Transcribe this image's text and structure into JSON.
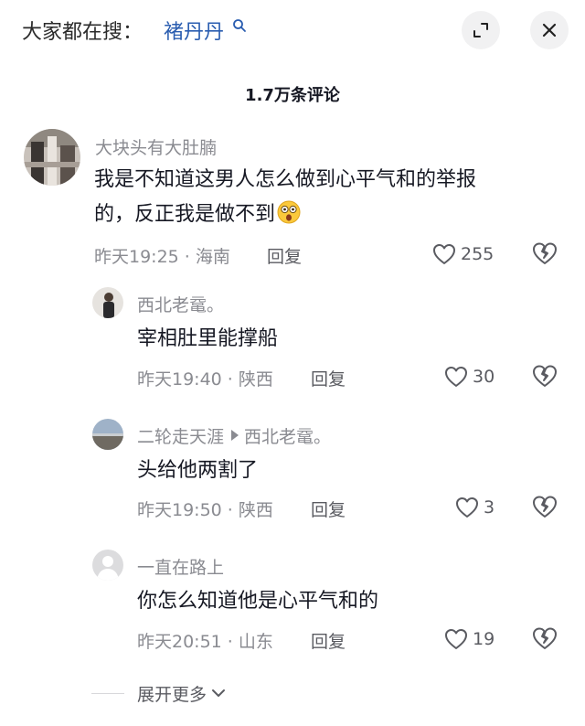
{
  "search": {
    "prefix": "大家都在搜：",
    "term": "褚丹丹"
  },
  "comments_header": {
    "count_label": "1.7万条评论"
  },
  "comments": [
    {
      "username": "大块头有大肚腩",
      "content_line1": "我是不知道这男人怎么做到心平气和的举报",
      "content_line2": "的，反正我是做不到",
      "time": "昨天19:25",
      "location": "海南",
      "reply_label": "回复",
      "likes": "255"
    }
  ],
  "replies": [
    {
      "username": "西北老鼋。",
      "content": "宰相肚里能撑船",
      "time": "昨天19:40",
      "location": "陕西",
      "reply_label": "回复",
      "likes": "30"
    },
    {
      "username": "二轮走天涯",
      "reply_to": "西北老鼋。",
      "content": "头给他两割了",
      "time": "昨天19:50",
      "location": "陕西",
      "reply_label": "回复",
      "likes": "3"
    },
    {
      "username": "一直在路上",
      "content": "你怎么知道他是心平气和的",
      "time": "昨天20:51",
      "location": "山东",
      "reply_label": "回复",
      "likes": "19"
    }
  ],
  "meta_separator": "·",
  "expand": {
    "label": "展开更多"
  },
  "icons": {
    "search_mini": "search-icon",
    "expand": "collapse-window-icon",
    "close": "close-icon",
    "like": "heart-outline-icon",
    "dislike": "broken-heart-icon",
    "chevron": "chevron-down-icon",
    "emoji": "shocked-face-emoji"
  },
  "colors": {
    "search_term": "#2a5db0",
    "secondary_text": "#8a8b91",
    "primary_text": "#161823"
  }
}
